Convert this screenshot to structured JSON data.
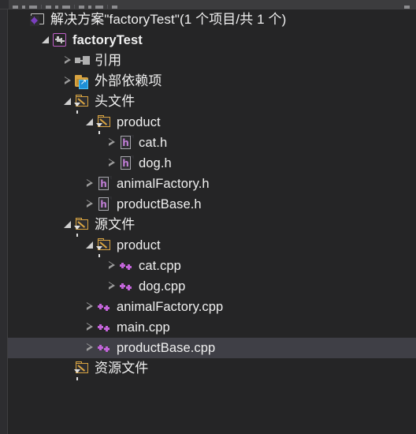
{
  "window": {
    "background": "#2d2d30",
    "pane_background": "#252526",
    "selection_color": "#3f3f46",
    "text_color": "#f0f0f0",
    "folder_color": "#d9a441",
    "cpp_accent": "#c264d8",
    "project_accent": "#c060c8"
  },
  "toolbar": {
    "name": "solution-explorer-toolbar",
    "visible": "partially-clipped"
  },
  "tree": {
    "name": "solution-explorer-tree",
    "nodes": [
      {
        "id": "solution",
        "label": "解决方案\"factoryTest\"(1 个项目/共 1 个)",
        "icon": "solution-icon",
        "depth": 0,
        "expander": "none",
        "bold": false,
        "cjk": true,
        "selected": false
      },
      {
        "id": "project",
        "label": "factoryTest",
        "icon": "cpp-project-icon",
        "depth": 1,
        "expander": "expanded",
        "bold": true,
        "cjk": false,
        "selected": false
      },
      {
        "id": "references",
        "label": "引用",
        "icon": "references-icon",
        "depth": 2,
        "expander": "collapsed",
        "bold": false,
        "cjk": true,
        "selected": false
      },
      {
        "id": "external-dependencies",
        "label": "外部依赖项",
        "icon": "external-dependencies-folder-icon",
        "depth": 2,
        "expander": "collapsed",
        "bold": false,
        "cjk": true,
        "selected": false
      },
      {
        "id": "header-files",
        "label": "头文件",
        "icon": "filter-folder-icon",
        "depth": 2,
        "expander": "expanded",
        "bold": false,
        "cjk": true,
        "selected": false
      },
      {
        "id": "header-product",
        "label": "product",
        "icon": "filter-folder-icon",
        "depth": 3,
        "expander": "expanded",
        "bold": false,
        "cjk": false,
        "selected": false
      },
      {
        "id": "cat-h",
        "label": "cat.h",
        "icon": "header-file-icon",
        "depth": 4,
        "expander": "collapsed",
        "bold": false,
        "cjk": false,
        "selected": false
      },
      {
        "id": "dog-h",
        "label": "dog.h",
        "icon": "header-file-icon",
        "depth": 4,
        "expander": "collapsed",
        "bold": false,
        "cjk": false,
        "selected": false
      },
      {
        "id": "animalfactory-h",
        "label": "animalFactory.h",
        "icon": "header-file-icon",
        "depth": 3,
        "expander": "collapsed",
        "bold": false,
        "cjk": false,
        "selected": false
      },
      {
        "id": "productbase-h",
        "label": "productBase.h",
        "icon": "header-file-icon",
        "depth": 3,
        "expander": "collapsed",
        "bold": false,
        "cjk": false,
        "selected": false
      },
      {
        "id": "source-files",
        "label": "源文件",
        "icon": "filter-folder-icon",
        "depth": 2,
        "expander": "expanded",
        "bold": false,
        "cjk": true,
        "selected": false
      },
      {
        "id": "source-product",
        "label": "product",
        "icon": "filter-folder-icon",
        "depth": 3,
        "expander": "expanded",
        "bold": false,
        "cjk": false,
        "selected": false
      },
      {
        "id": "cat-cpp",
        "label": "cat.cpp",
        "icon": "cpp-file-icon",
        "depth": 4,
        "expander": "collapsed",
        "bold": false,
        "cjk": false,
        "selected": false
      },
      {
        "id": "dog-cpp",
        "label": "dog.cpp",
        "icon": "cpp-file-icon",
        "depth": 4,
        "expander": "collapsed",
        "bold": false,
        "cjk": false,
        "selected": false
      },
      {
        "id": "animalfactory-cpp",
        "label": "animalFactory.cpp",
        "icon": "cpp-file-icon",
        "depth": 3,
        "expander": "collapsed",
        "bold": false,
        "cjk": false,
        "selected": false
      },
      {
        "id": "main-cpp",
        "label": "main.cpp",
        "icon": "cpp-file-icon",
        "depth": 3,
        "expander": "collapsed",
        "bold": false,
        "cjk": false,
        "selected": false
      },
      {
        "id": "productbase-cpp",
        "label": "productBase.cpp",
        "icon": "cpp-file-icon",
        "depth": 3,
        "expander": "collapsed",
        "bold": false,
        "cjk": false,
        "selected": true
      },
      {
        "id": "resource-files",
        "label": "资源文件",
        "icon": "filter-folder-icon",
        "depth": 2,
        "expander": "none",
        "bold": false,
        "cjk": true,
        "selected": false
      }
    ]
  }
}
